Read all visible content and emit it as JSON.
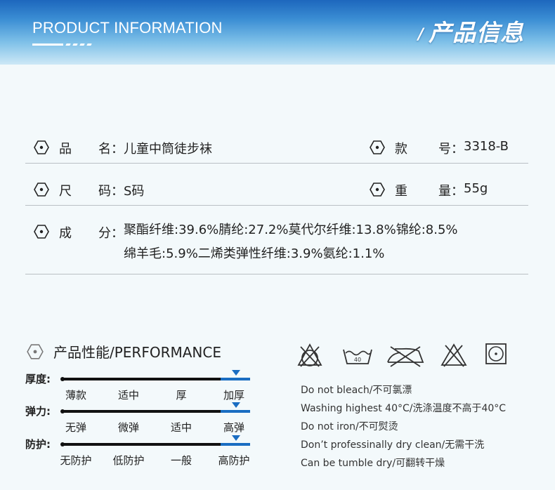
{
  "header": {
    "title_en": "PRODUCT INFORMATION",
    "slash": "/",
    "title_cn": "产品信息"
  },
  "info": {
    "name": {
      "label_a": "品",
      "label_b": "名",
      "sep": "：",
      "value": "儿童中筒徒步袜"
    },
    "style": {
      "label_a": "款",
      "label_b": "号",
      "sep": "：",
      "value": "3318-B"
    },
    "size": {
      "label_a": "尺",
      "label_b": "码",
      "sep": "：",
      "value": "S码"
    },
    "weight": {
      "label_a": "重",
      "label_b": "量",
      "sep": "：",
      "value": "55g"
    },
    "composition": {
      "label_a": "成",
      "label_b": "分",
      "sep": "：",
      "line1": "聚酯纤维:39.6%腈纶:27.2%莫代尔纤维:13.8%锦纶:8.5%",
      "line2": "绵羊毛:5.9%二烯类弹性纤维:3.9%氨纶:1.1%"
    }
  },
  "performance": {
    "title": "产品性能/PERFORMANCE",
    "bars": [
      {
        "label": "厚度:",
        "options": [
          "薄款",
          "适中",
          "厚",
          "加厚"
        ],
        "selected": "加厚"
      },
      {
        "label": "弹力:",
        "options": [
          "无弹",
          "微弹",
          "适中",
          "高弹"
        ],
        "selected": "高弹"
      },
      {
        "label": "防护:",
        "options": [
          "无防护",
          "低防护",
          "一般",
          "高防护"
        ],
        "selected": "高防护"
      }
    ],
    "accent_color": "#1a6dc2"
  },
  "care": {
    "icons": [
      "no-bleach-icon",
      "wash-40-icon",
      "no-iron-icon",
      "no-dry-clean-icon",
      "tumble-dry-icon"
    ],
    "wash_temp_label": "40",
    "instructions": [
      "Do not bleach/不可氯漂",
      "Washing  highest 40°C/洗涤温度不高于40°C",
      "Do not iron/不可熨烫",
      "Don’t professinally dry clean/无需干洗",
      "Can be tumble dry/可翻转干燥"
    ]
  }
}
